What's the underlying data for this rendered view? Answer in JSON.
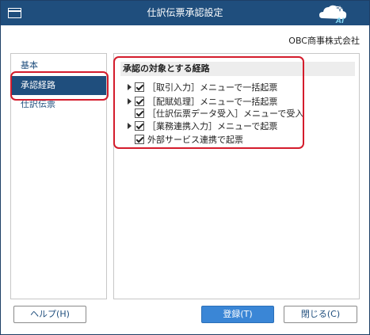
{
  "window": {
    "title": "仕訳伝票承認設定",
    "company": "OBC商事株式会社",
    "logo_text": "AI"
  },
  "sidebar": {
    "items": [
      {
        "label": "基本",
        "selected": false
      },
      {
        "label": "承認経路",
        "selected": true
      },
      {
        "label": "仕訳伝票",
        "selected": false
      }
    ]
  },
  "panel": {
    "title": "承認の対象とする経路",
    "routes": [
      {
        "label": "［取引入力］メニューで一括起票",
        "expandable": true,
        "checked": true
      },
      {
        "label": "［配賦処理］メニューで一括起票",
        "expandable": true,
        "checked": true
      },
      {
        "label": "［仕訳伝票データ受入］メニューで受入",
        "expandable": false,
        "checked": true
      },
      {
        "label": "［業務連携入力］メニューで起票",
        "expandable": true,
        "checked": true
      },
      {
        "label": "外部サービス連携で起票",
        "expandable": false,
        "checked": true
      }
    ]
  },
  "buttons": {
    "help": "ヘルプ(H)",
    "register": "登録(T)",
    "close": "閉じる(C)"
  },
  "colors": {
    "titlebar": "#1f4e7d",
    "selected_item": "#1f4e7d",
    "highlight_box": "#d41c2c",
    "primary_button": "#3a86d6"
  }
}
